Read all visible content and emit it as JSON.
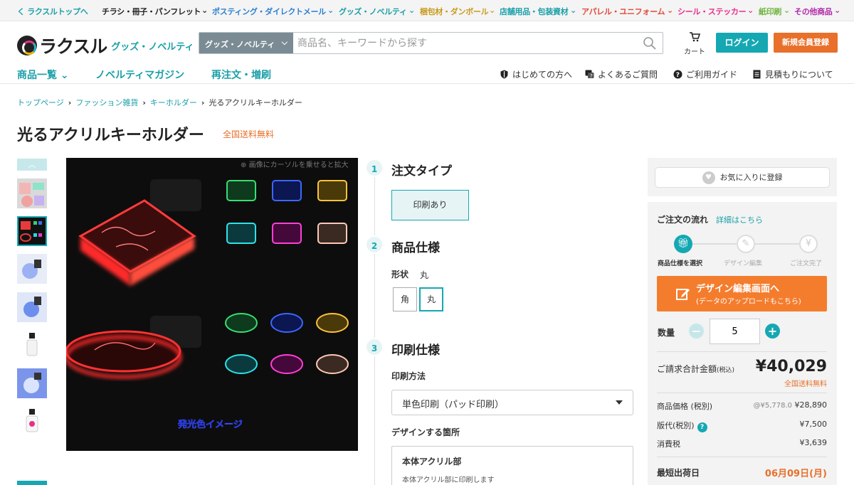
{
  "categories": [
    {
      "label": "く ラクスルトップへ",
      "color": "#1a9fa8"
    },
    {
      "label": "チラシ・冊子・パンフレット",
      "color": "#222222"
    },
    {
      "label": "ポスティング・ダイレクトメール",
      "color": "#2b7fd0"
    },
    {
      "label": "グッズ・ノベルティ",
      "color": "#1a9fa8"
    },
    {
      "label": "梱包材・ダンボール",
      "color": "#c89b1e"
    },
    {
      "label": "店舗用品・包装資材",
      "color": "#1a9fa8"
    },
    {
      "label": "アパレル・ユニフォーム",
      "color": "#e04a3a"
    },
    {
      "label": "シール・ステッカー",
      "color": "#e8308a"
    },
    {
      "label": "紙印刷",
      "color": "#6fb33d"
    },
    {
      "label": "その他商品",
      "color": "#b02aa8"
    }
  ],
  "header": {
    "logo_text": "ラクスル",
    "logo_sub": "グッズ・ノベルティ",
    "search_category": "グッズ・ノベルティ",
    "search_placeholder": "商品名、キーワードから探す",
    "cart_label": "カート",
    "login_label": "ログイン",
    "signup_label": "新規会員登録"
  },
  "nav": {
    "main": [
      "商品一覧",
      "ノベルティマガジン",
      "再注文・増刷"
    ],
    "help": [
      "はじめての方へ",
      "よくあるご質問",
      "ご利用ガイド",
      "見積もりについて"
    ]
  },
  "breadcrumb": [
    "トップページ",
    "ファッション雑貨",
    "キーホルダー",
    "光るアクリルキーホルダー"
  ],
  "product": {
    "title": "光るアクリルキーホルダー",
    "free_shipping": "全国送料無料",
    "zoom_hint": "画像にカーソルを乗せると拡大",
    "image_caption": "発光色イメージ"
  },
  "options": {
    "step1": {
      "num": "1",
      "title": "注文タイプ",
      "choice": "印刷あり"
    },
    "step2": {
      "num": "2",
      "title": "商品仕様",
      "shape_label": "形状",
      "shape_value": "丸",
      "shapes": [
        "角",
        "丸"
      ]
    },
    "step3": {
      "num": "3",
      "title": "印刷仕様",
      "method_label": "印刷方法",
      "method_value": "単色印刷（パッド印刷）",
      "design_label": "デザインする箇所",
      "place_title": "本体アクリル部",
      "place_desc": "本体アクリル部に印刷します"
    }
  },
  "sidebar": {
    "favorite": "お気に入りに登録",
    "flow_title": "ご注文の流れ",
    "flow_link": "詳細はこちら",
    "flow_steps": [
      "商品仕様を選択",
      "デザイン編集",
      "ご注文完了"
    ],
    "design_btn_l1": "デザイン編集画面へ",
    "design_btn_l2": "(データのアップロードもこちら)",
    "qty_label": "数量",
    "qty_value": "5",
    "total_label": "ご請求合計金額",
    "total_tax": "(税込)",
    "total_value": "¥40,029",
    "total_ship": "全国送料無料",
    "rows": [
      {
        "k": "商品価格 (税別)",
        "unit": "@¥5,778.0",
        "v": "¥28,890"
      },
      {
        "k": "版代(税別)",
        "unit": "",
        "v": "¥7,500"
      },
      {
        "k": "消費税",
        "unit": "",
        "v": "¥3,639"
      }
    ],
    "ship_label": "最短出荷日",
    "ship_date": "06月09日(月)"
  },
  "colors": {
    "accent": "#15a8b3",
    "orange": "#e8702a",
    "cta": "#f47d2d"
  }
}
